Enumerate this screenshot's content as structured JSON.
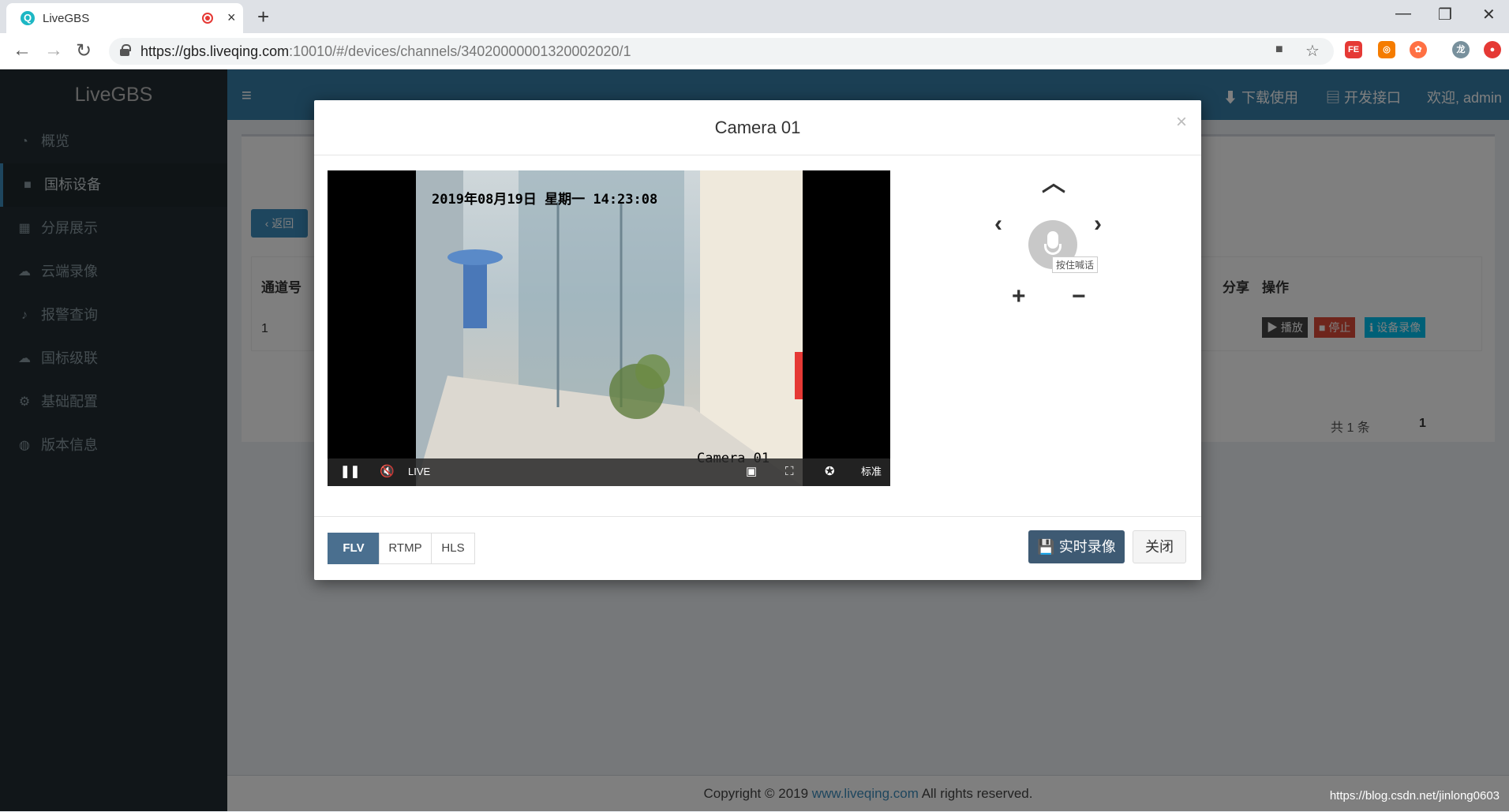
{
  "browser": {
    "tab_title": "LiveGBS",
    "tab_close": "×",
    "new_tab": "+",
    "url_host": "https://gbs.liveqing.com",
    "url_rest": ":10010/#/devices/channels/34020000001320002020/1",
    "win_min": "—",
    "win_max": "❐",
    "win_close": "✕"
  },
  "app": {
    "brand": "LiveGBS",
    "topnav": {
      "download": "下载使用",
      "api": "开发接口",
      "welcome": "欢迎, admin"
    },
    "sidebar": [
      {
        "label": "概览",
        "icon": "dashboard-icon"
      },
      {
        "label": "国标设备",
        "icon": "video-camera-icon"
      },
      {
        "label": "分屏展示",
        "icon": "grid-icon"
      },
      {
        "label": "云端录像",
        "icon": "cloud-icon"
      },
      {
        "label": "报警查询",
        "icon": "bell-icon"
      },
      {
        "label": "国标级联",
        "icon": "cloud-upload-icon"
      },
      {
        "label": "基础配置",
        "icon": "gears-icon"
      },
      {
        "label": "版本信息",
        "icon": "globe-icon"
      }
    ],
    "back_button": "返回",
    "table": {
      "headers": [
        "通道号",
        "分享",
        "操作"
      ],
      "row_index": "1",
      "actions": {
        "play": "播放",
        "stop": "停止",
        "record": "设备录像"
      }
    },
    "pagination": {
      "total": "共 1 条",
      "page": "1"
    },
    "footer": {
      "prefix": "Copyright © 2019 ",
      "link": "www.liveqing.com",
      "suffix": " All rights reserved."
    },
    "watermark": "https://blog.csdn.net/jinlong0603"
  },
  "modal": {
    "title": "Camera 01",
    "close": "×",
    "video": {
      "osd_time": "2019年08月19日 星期一 14:23:08",
      "osd_camera": "Camera 01",
      "live_label": "LIVE",
      "quality_label": "标准"
    },
    "ptz": {
      "mic_tooltip": "按住喊话"
    },
    "formats": [
      "FLV",
      "RTMP",
      "HLS"
    ],
    "selected_format": "FLV",
    "record_button": "实时录像",
    "close_button": "关闭"
  },
  "colors": {
    "accent": "#3c8dbc",
    "sidebar": "#222d32",
    "record_button": "#3e5a73"
  }
}
